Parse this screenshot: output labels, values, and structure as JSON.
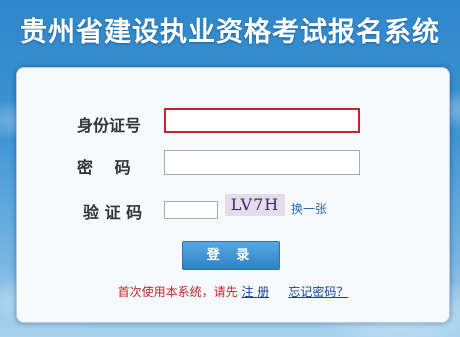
{
  "header": {
    "title": "贵州省建设执业资格考试报名系统"
  },
  "form": {
    "id_label": "身份证号",
    "id_value": "",
    "password_label": "密　 码",
    "password_value": "",
    "captcha_label": "验 证 码",
    "captcha_value": "",
    "captcha_image_text": "LV7H",
    "change_captcha_link": "换一张",
    "login_button": "登 录"
  },
  "footer": {
    "hint": "首次使用本系统，请先",
    "register_link": "注  册",
    "forgot_link": "忘记密码？"
  },
  "colors": {
    "accent_blue": "#2e82c6",
    "error_red": "#c0262b",
    "link_blue": "#1a3fa0"
  }
}
